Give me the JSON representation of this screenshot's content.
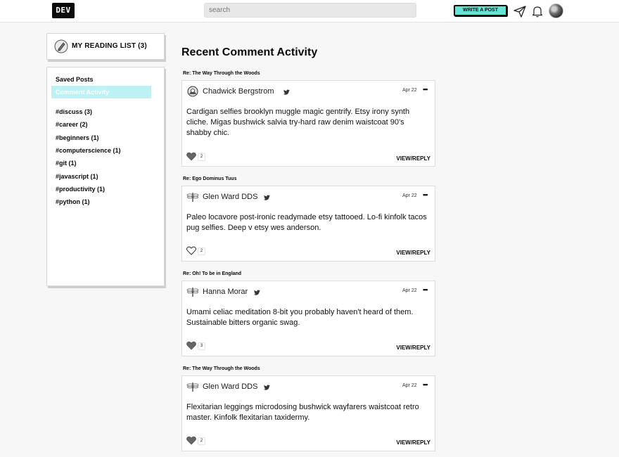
{
  "nav": {
    "logo": "DEV",
    "search_placeholder": "search",
    "write_post": "WRITE A POST"
  },
  "reading_list": {
    "title": "MY READING LIST (3)"
  },
  "sidebar": {
    "items": [
      {
        "label": "Saved Posts"
      },
      {
        "label": "Comment Activity",
        "active": true
      },
      {
        "label": "#discuss (3)"
      },
      {
        "label": "#career (2)"
      },
      {
        "label": "#beginners (1)"
      },
      {
        "label": "#computerscience (1)"
      },
      {
        "label": "#git (1)"
      },
      {
        "label": "#javascript (1)"
      },
      {
        "label": "#productivity (1)"
      },
      {
        "label": "#python (1)"
      }
    ]
  },
  "main": {
    "heading": "Recent Comment Activity",
    "comments": [
      {
        "re": "Re: The Way Through the Woods",
        "author": "Chadwick Bergstrom",
        "date": "Apr 22",
        "body": "Cardigan selfies brooklyn muggle magic gentrify. Etsy irony synth cliche. Migas bushwick salvia try-hard raw denim waistcoat 90's shabby chic.",
        "likes": "2",
        "liked": true,
        "reply": "VIEW/REPLY"
      },
      {
        "re": "Re: Ego Dominus Tuus",
        "author": "Glen Ward DDS",
        "date": "Apr 22",
        "body": "Paleo locavore post-ironic readymade etsy tattooed. Lo-fi kinfolk tacos pug selfies. Deep v etsy wes anderson.",
        "likes": "2",
        "liked": false,
        "reply": "VIEW/REPLY"
      },
      {
        "re": "Re: Oh! To be in England",
        "author": "Hanna Morar",
        "date": "Apr 22",
        "body": "Umami celiac meditation 8-bit you probably haven't heard of them. Sustainable bitters organic swag.",
        "likes": "3",
        "liked": true,
        "reply": "VIEW/REPLY"
      },
      {
        "re": "Re: The Way Through the Woods",
        "author": "Glen Ward DDS",
        "date": "Apr 22",
        "body": "Flexitarian leggings microdosing bushwick wayfarers waistcoat retro master. Kinfolk flexitarian taxidermy.",
        "likes": "2",
        "liked": true,
        "reply": "VIEW/REPLY"
      }
    ]
  },
  "colors": {
    "accent": "#66e2d5",
    "active_bg": "#bdf1f3",
    "page_bg": "#f7f7f7"
  },
  "icons": {
    "send": "paper-plane-icon",
    "notifications": "bell-icon",
    "reading_list": "book-icon",
    "twitter": "twitter-icon",
    "heart": "heart-icon",
    "more": "ellipsis-icon"
  }
}
